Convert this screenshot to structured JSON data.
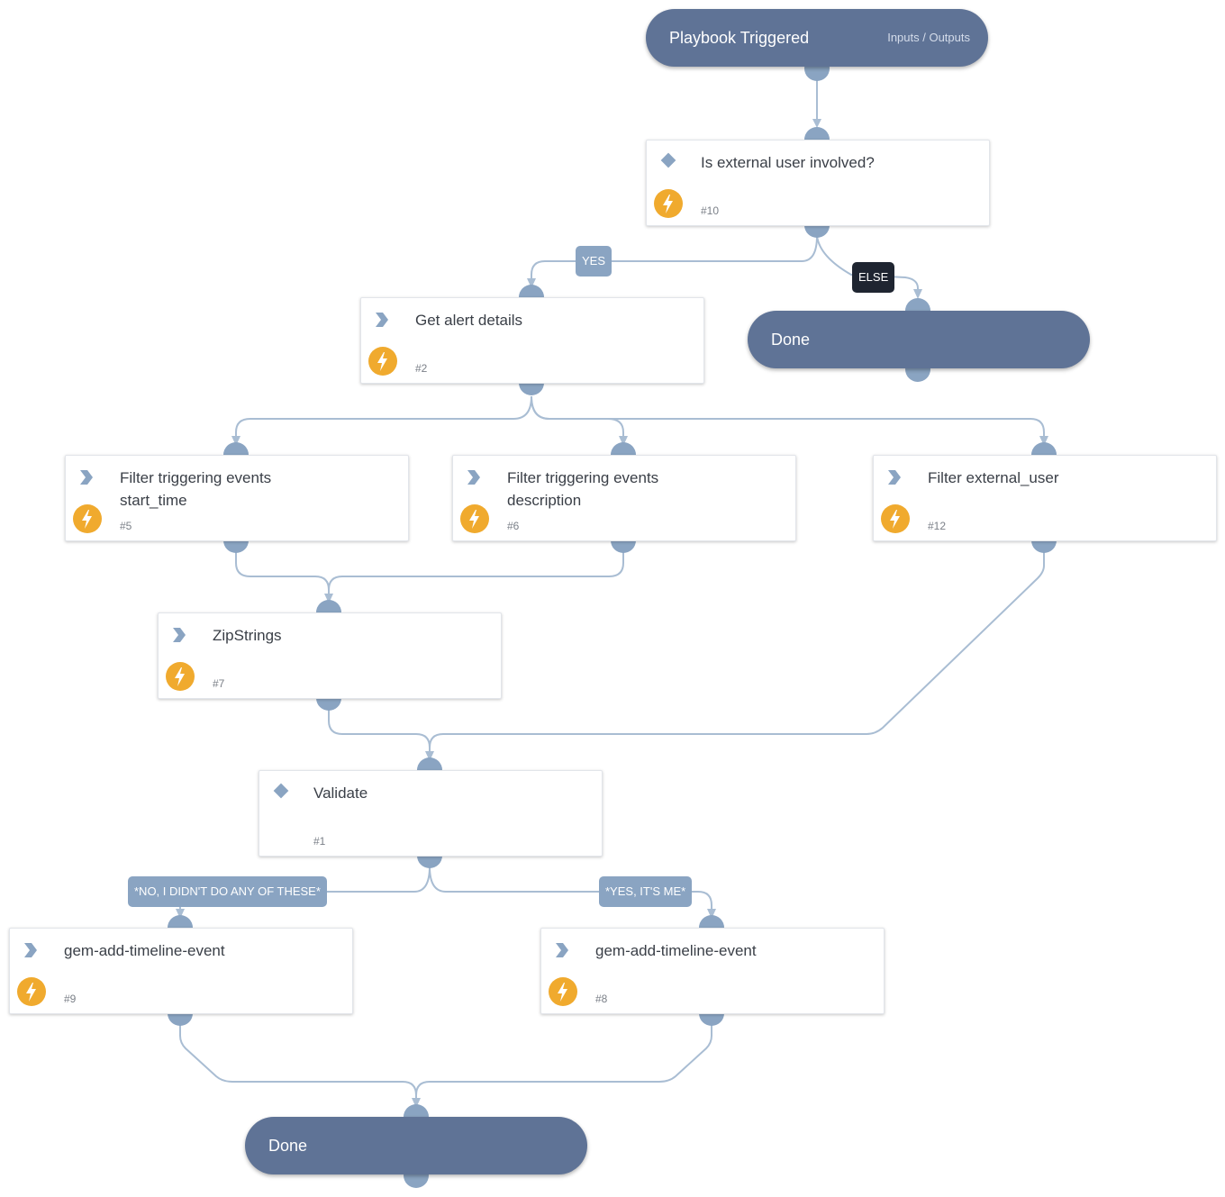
{
  "colors": {
    "pill": "#5f7396",
    "port": "#8aa4c2",
    "edge": "#a9bdd3",
    "bolt": "#f0aa2e",
    "condition_label": "#8aa4c2",
    "else_label": "#1f2531"
  },
  "nodes": {
    "start": {
      "title": "Playbook Triggered",
      "io_link": "Inputs / Outputs"
    },
    "n10": {
      "title": "Is external user involved?",
      "number": "#10",
      "type_icon": "diamond-icon",
      "has_bolt": true
    },
    "n2": {
      "title": "Get alert details",
      "number": "#2",
      "type_icon": "chevron-icon",
      "has_bolt": true
    },
    "done_top": {
      "title": "Done"
    },
    "n5": {
      "title_line1": "Filter triggering events",
      "title_line2": "start_time",
      "number": "#5",
      "type_icon": "chevron-icon",
      "has_bolt": true
    },
    "n6": {
      "title_line1": "Filter triggering events",
      "title_line2": "description",
      "number": "#6",
      "type_icon": "chevron-icon",
      "has_bolt": true
    },
    "n12": {
      "title": "Filter external_user",
      "number": "#12",
      "type_icon": "chevron-icon",
      "has_bolt": true
    },
    "n7": {
      "title": "ZipStrings",
      "number": "#7",
      "type_icon": "chevron-icon",
      "has_bolt": true
    },
    "n1": {
      "title": "Validate",
      "number": "#1",
      "type_icon": "diamond-icon",
      "has_bolt": false
    },
    "n9": {
      "title": "gem-add-timeline-event",
      "number": "#9",
      "type_icon": "chevron-icon",
      "has_bolt": true
    },
    "n8": {
      "title": "gem-add-timeline-event",
      "number": "#8",
      "type_icon": "chevron-icon",
      "has_bolt": true
    },
    "done_bottom": {
      "title": "Done"
    }
  },
  "edge_labels": {
    "yes": "YES",
    "else": "ELSE",
    "no_didnt": "*NO, I DIDN'T DO ANY OF THESE*",
    "yes_its_me": "*YES, IT'S ME*"
  },
  "edges": [
    {
      "from": "start",
      "to": "n10",
      "label": ""
    },
    {
      "from": "n10",
      "to": "n2",
      "label": "YES"
    },
    {
      "from": "n10",
      "to": "done_top",
      "label": "ELSE"
    },
    {
      "from": "n2",
      "to": "n5",
      "label": ""
    },
    {
      "from": "n2",
      "to": "n6",
      "label": ""
    },
    {
      "from": "n2",
      "to": "n12",
      "label": ""
    },
    {
      "from": "n5",
      "to": "n7",
      "label": ""
    },
    {
      "from": "n6",
      "to": "n7",
      "label": ""
    },
    {
      "from": "n7",
      "to": "n1",
      "label": ""
    },
    {
      "from": "n12",
      "to": "n1",
      "label": ""
    },
    {
      "from": "n1",
      "to": "n9",
      "label": "*NO, I DIDN'T DO ANY OF THESE*"
    },
    {
      "from": "n1",
      "to": "n8",
      "label": "*YES, IT'S ME*"
    },
    {
      "from": "n9",
      "to": "done_bottom",
      "label": ""
    },
    {
      "from": "n8",
      "to": "done_bottom",
      "label": ""
    }
  ]
}
